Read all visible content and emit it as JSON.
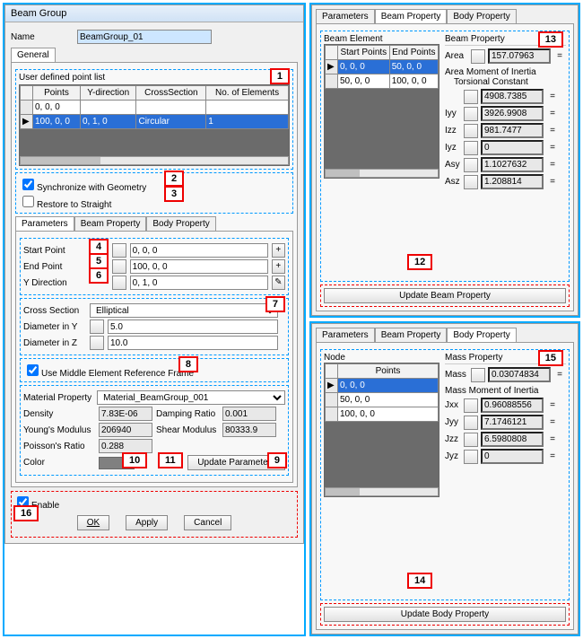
{
  "left": {
    "title": "Beam Group",
    "nameLabel": "Name",
    "nameValue": "BeamGroup_01",
    "generalTab": "General",
    "userPointList": "User defined point list",
    "gridHeaders": {
      "points": "Points",
      "ydir": "Y-direction",
      "cross": "CrossSection",
      "noel": "No. of Elements"
    },
    "gridRows": [
      {
        "points": "0, 0, 0",
        "ydir": "",
        "cross": "",
        "noel": ""
      },
      {
        "points": "100, 0, 0",
        "ydir": "0, 1, 0",
        "cross": "Circular",
        "noel": "1",
        "sel": true
      }
    ],
    "syncGeom": "Synchronize with Geometry",
    "restore": "Restore to Straight",
    "tabs": {
      "param": "Parameters",
      "beam": "Beam Property",
      "body": "Body Property"
    },
    "startPoint": "Start Point",
    "startVal": "0, 0, 0",
    "endPoint": "End Point",
    "endVal": "100, 0, 0",
    "ydirLbl": "Y Direction",
    "ydirVal": "0, 1, 0",
    "crossSection": "Cross Section",
    "crossVal": "Elliptical",
    "diaY": "Diameter in Y",
    "diaYVal": "5.0",
    "diaZ": "Diameter in Z",
    "diaZVal": "10.0",
    "useMiddle": "Use Middle Element Reference Frame",
    "matProp": "Material Property",
    "matVal": "Material_BeamGroup_001",
    "density": "Density",
    "densityVal": "7.83E-06",
    "damping": "Damping Ratio",
    "dampingVal": "0.001",
    "young": "Young's Modulus",
    "youngVal": "206940",
    "shear": "Shear Modulus",
    "shearVal": "80333.9",
    "poisson": "Poisson's Ratio",
    "poissonVal": "0.288",
    "color": "Color",
    "updateParam": "Update Parameters",
    "enable": "Enable",
    "ok": "OK",
    "apply": "Apply",
    "cancel": "Cancel"
  },
  "right1": {
    "beamElement": "Beam Element",
    "startPts": "Start Points",
    "endPts": "End Points",
    "rows": [
      {
        "s": "0, 0, 0",
        "e": "50, 0, 0",
        "sel": true
      },
      {
        "s": "50, 0, 0",
        "e": "100, 0, 0"
      }
    ],
    "beamProperty": "Beam Property",
    "area": "Area",
    "areaVal": "157.07963",
    "ami": "Area Moment of Inertia",
    "tors": "Torsional Constant",
    "torsVal": "4908.7385",
    "iyy": "Iyy",
    "iyyVal": "3926.9908",
    "izz": "Izz",
    "izzVal": "981.7477",
    "iyz": "Iyz",
    "iyzVal": "0",
    "asy": "Asy",
    "asyVal": "1.1027632",
    "asz": "Asz",
    "aszVal": "1.208814",
    "update": "Update Beam Property"
  },
  "right2": {
    "node": "Node",
    "points": "Points",
    "rows": [
      {
        "p": "0, 0, 0",
        "sel": true
      },
      {
        "p": "50, 0, 0"
      },
      {
        "p": "100, 0, 0"
      }
    ],
    "massProperty": "Mass Property",
    "mass": "Mass",
    "massVal": "0.03074834",
    "mmoi": "Mass Moment of Inertia",
    "jxx": "Jxx",
    "jxxVal": "0.96088556",
    "jyy": "Jyy",
    "jyyVal": "7.1746121",
    "jzz": "Jzz",
    "jzzVal": "6.5980808",
    "jyz": "Jyz",
    "jyzVal": "0",
    "update": "Update Body Property"
  },
  "callouts": {
    "c1": "1",
    "c2": "2",
    "c3": "3",
    "c4": "4",
    "c5": "5",
    "c6": "6",
    "c7": "7",
    "c8": "8",
    "c9": "9",
    "c10": "10",
    "c11": "11",
    "c12": "12",
    "c13": "13",
    "c14": "14",
    "c15": "15",
    "c16": "16"
  }
}
